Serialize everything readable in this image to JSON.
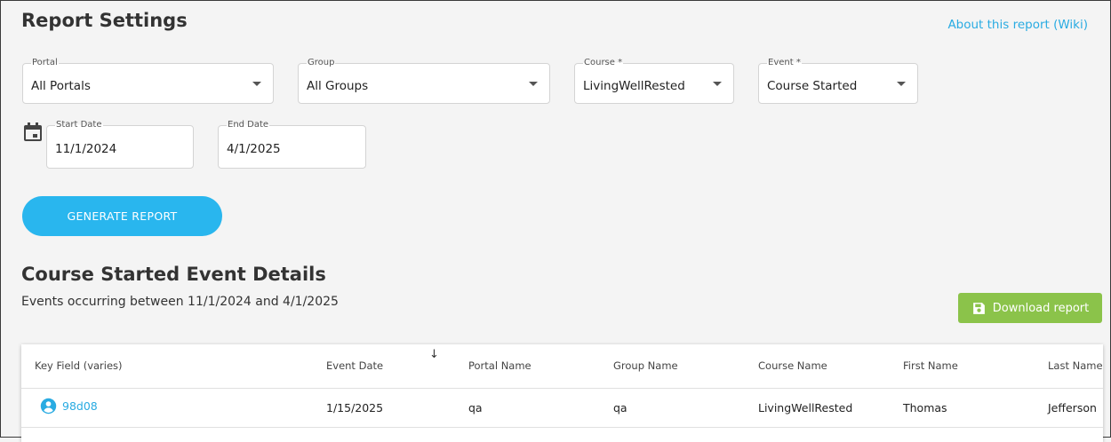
{
  "header": {
    "title": "Report Settings",
    "wiki_link": "About this report (Wiki)"
  },
  "filters": {
    "portal": {
      "label": "Portal",
      "value": "All Portals"
    },
    "group": {
      "label": "Group",
      "value": "All Groups"
    },
    "course": {
      "label": "Course *",
      "value": "LivingWellRested"
    },
    "event": {
      "label": "Event *",
      "value": "Course Started"
    },
    "start_date": {
      "label": "Start Date",
      "value": "11/1/2024"
    },
    "end_date": {
      "label": "End Date",
      "value": "4/1/2025"
    }
  },
  "generate_button": "GENERATE REPORT",
  "details": {
    "title": "Course Started Event Details",
    "subtitle": "Events occurring between 11/1/2024 and 4/1/2025",
    "download_label": "Download report"
  },
  "table": {
    "sort_indicator": "↓",
    "columns": [
      "Key Field (varies)",
      "Event Date",
      "Portal Name",
      "Group Name",
      "Course Name",
      "First Name",
      "Last Name"
    ],
    "rows": [
      [
        "98d08",
        "1/15/2025",
        "qa",
        "qa",
        "LivingWellRested",
        "Thomas",
        "Jefferson"
      ]
    ]
  },
  "colors": {
    "accent": "#29b6ee",
    "link": "#29abe2",
    "download": "#8bc34a"
  },
  "icons": {
    "calendar": "calendar-icon",
    "dropdown": "chevron-down-icon",
    "save": "floppy-disk-icon",
    "user": "user-circle-icon"
  }
}
